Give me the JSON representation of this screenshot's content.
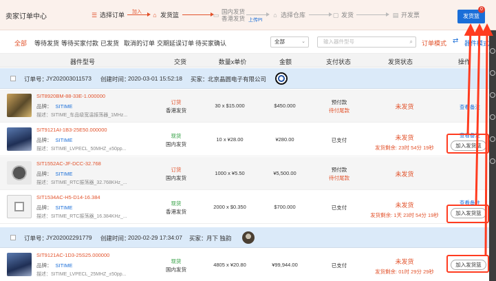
{
  "header": {
    "title": "卖家订单中心",
    "steps": [
      "选择订单",
      "发货篮",
      "国内发货",
      "香港发货",
      "选择仓库",
      "发货",
      "开发票"
    ],
    "arrow_add_label": "加入",
    "arrow_upload_label": "上传PI",
    "ship_basket_button": "发货篮",
    "ship_basket_count": "0"
  },
  "filters": {
    "tabs": [
      "全部",
      "等待发货",
      "等待买家付款",
      "已发货",
      "取消的订单",
      "交期延误订单",
      "待买家确认"
    ],
    "select_value": "全部",
    "search_placeholder": "输入器件型号",
    "mode_label": "订单模式",
    "mode2_label": "器件模式"
  },
  "columns": [
    "器件型号",
    "交货",
    "数量x单价",
    "金额",
    "支付状态",
    "发货状态",
    "操作"
  ],
  "labels": {
    "order_no": "订单号：",
    "created": "创建时间：",
    "buyer": "买家：",
    "brand": "品牌：",
    "desc": "描述：",
    "view_note": "查看备注",
    "add_to_basket": "加入发货篮"
  },
  "orders": [
    {
      "order_id": "JY202003011573",
      "created": "2020-03-01 15:52:18",
      "buyer": "北京晶圆电子有限公司",
      "items": [
        {
          "part": "SIT8920BM-88-33E-1.000000",
          "brand": "SITIME",
          "desc": "SITIME_车品级宽温振荡器_1MHz...",
          "stock": "订货",
          "origin": "香港发货",
          "qty": "30 x $15.000",
          "amount": "$450.000",
          "pay1": "预付款",
          "pay2": "待付尾款",
          "ship": "未发货",
          "countdown": ""
        },
        {
          "part": "SIT9121AI-1B3-25E50.000000",
          "brand": "SITIME",
          "desc": "SITIME_LVPECL_50MHZ_±50pp...",
          "stock": "现货",
          "origin": "国内发货",
          "qty": "10 x ¥28.00",
          "amount": "¥280.00",
          "pay1": "已支付",
          "pay2": "",
          "ship": "未发货",
          "countdown": "发货剩余: 23时 54分 19秒"
        },
        {
          "part": "SIT1552AC-JF-DCC-32.768",
          "brand": "SITIME",
          "desc": "SITIME_RTC振荡器_32.768KHz_...",
          "stock": "订货",
          "origin": "国内发货",
          "qty": "1000 x ¥5.50",
          "amount": "¥5,500.00",
          "pay1": "预付款",
          "pay2": "待付尾款",
          "ship": "未发货",
          "countdown": ""
        },
        {
          "part": "SIT1534AC-H5-D14-16.384",
          "brand": "SITIME",
          "desc": "SITIME_RTC振荡器_16.384KHz_...",
          "stock": "现货",
          "origin": "香港发货",
          "qty": "2000 x $0.350",
          "amount": "$700.000",
          "pay1": "已支付",
          "pay2": "",
          "ship": "未发货",
          "countdown": "发货剩余: 1天 23时 54分 19秒"
        }
      ]
    },
    {
      "order_id": "JY202002291779",
      "created": "2020-02-29 17:34:07",
      "buyer": "月下 独韵",
      "items": [
        {
          "part": "SIT9121AC-1D3-25S25.000000",
          "brand": "SITIME",
          "desc": "SITIME_LVPECL_25MHZ_±50pp...",
          "stock": "现货",
          "origin": "国内发货",
          "qty": "4805 x ¥20.80",
          "amount": "¥99,944.00",
          "pay1": "已支付",
          "pay2": "",
          "ship": "未发货",
          "countdown": "发货剩余: 01时 29分 29秒"
        }
      ]
    }
  ],
  "colors": {
    "accent": "#e2522b",
    "link": "#1a6ed8",
    "order_header": "#dbeaf9",
    "stock_green": "#2e9d3e",
    "annotation": "#ff3b1f"
  }
}
